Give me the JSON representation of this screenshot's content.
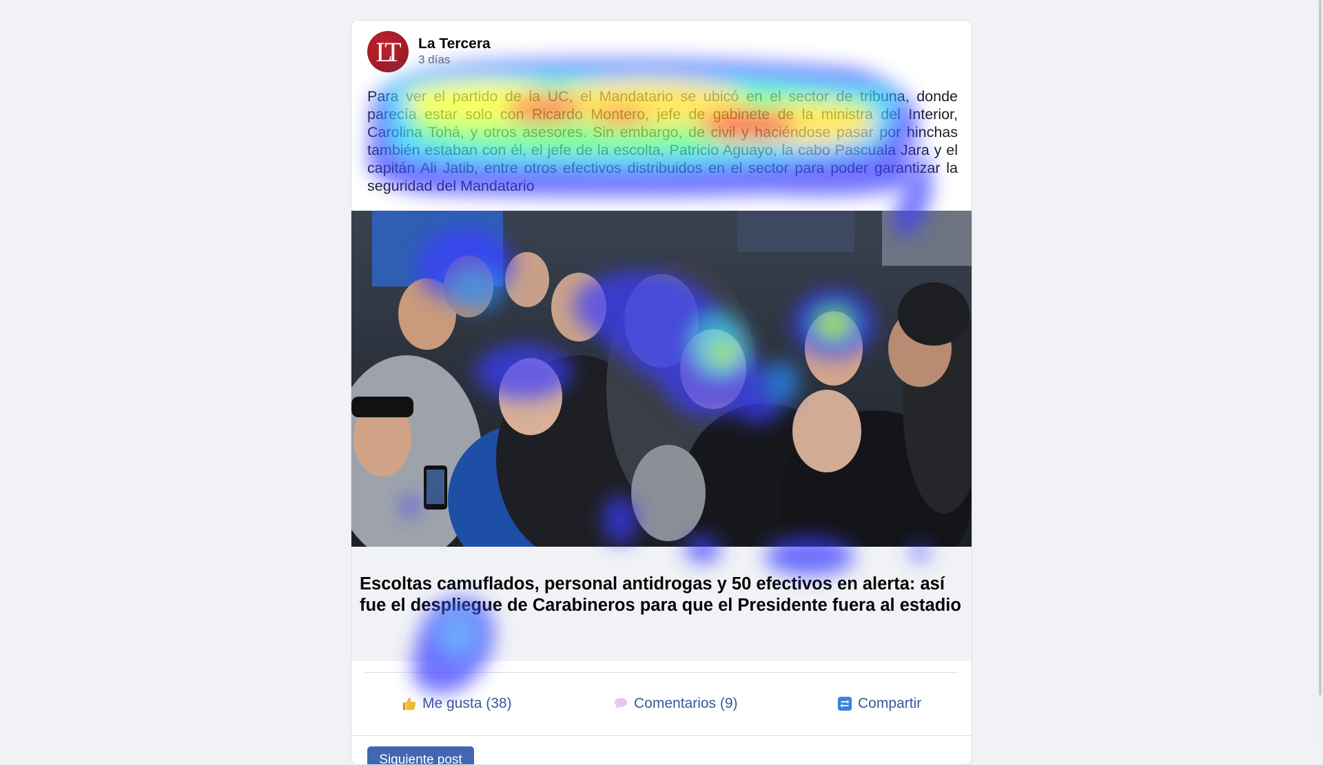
{
  "post": {
    "author": "La Tercera",
    "time": "3 días",
    "avatar_letters": "LT",
    "text": "Para ver el partido de la UC, el Mandatario se ubicó en el sector de tribuna, donde parecía estar solo con Ricardo Montero, jefe de gabinete de la ministra del Interior, Carolina Tohá, y otros asesores. Sin embargo, de civil y haciéndose pasar por hinchas también estaban con él, el jefe de la escolta, Patricio Aguayo, la cabo Pascuala Jara y el capitán Ali Jatib, entre otros efectivos distribuidos en el sector para poder garantizar la seguridad del Mandatario",
    "link_title": "Escoltas camuflados, personal antidrogas y 50 efectivos en alerta: así fue el despliegue de Carabineros para que el Presidente fuera al estadio"
  },
  "actions": {
    "like_label": "Me gusta (38)",
    "comment_label": "Comentarios (9)",
    "share_label": "Compartir"
  },
  "navigation": {
    "next_label": "Siguiente post"
  },
  "icons": {
    "like": "thumbs-up-icon",
    "comment": "speech-bubble-icon",
    "share": "share-arrows-icon",
    "avatar": "la-tercera-logo"
  },
  "colors": {
    "brand_red": "#b01e2b",
    "link_blue": "#385898",
    "button_blue": "#4267b2",
    "page_bg": "#f0f2f5"
  }
}
